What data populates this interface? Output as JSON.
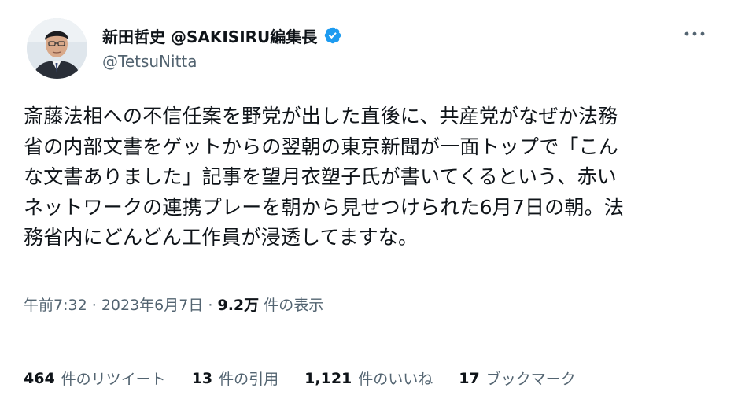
{
  "author": {
    "display_name": "新田哲史 @SAKISIRU編集長",
    "handle": "@TetsuNitta",
    "verified_icon": "verified-badge-icon",
    "verified_color": "#1d9bf0"
  },
  "more_icon": "more-dots-icon",
  "tweet": {
    "lines": [
      "斎藤法相への不信任案を野党が出した直後に、共産党がなぜか法務",
      "省の内部文書をゲットからの翌朝の東京新聞が一面トップで「こん",
      "な文書ありました」記事を望月衣塑子氏が書いてくるという、赤い",
      "ネットワークの連携プレーを朝から見せつけられた6月7日の朝。法",
      "務省内にどんどん工作員が浸透してますな。"
    ]
  },
  "meta": {
    "time": "午前7:32",
    "separator": "·",
    "date": "2023年6月7日",
    "views_count": "9.2万",
    "views_label": "件の表示"
  },
  "stats": {
    "retweets_count": "464",
    "retweets_label": "件のリツイート",
    "quotes_count": "13",
    "quotes_label": "件の引用",
    "likes_count": "1,121",
    "likes_label": "件のいいね",
    "bookmarks_count": "17",
    "bookmarks_label": "ブックマーク"
  },
  "colors": {
    "text_primary": "#0f1419",
    "text_secondary": "#536471",
    "divider": "#e6ebef"
  }
}
